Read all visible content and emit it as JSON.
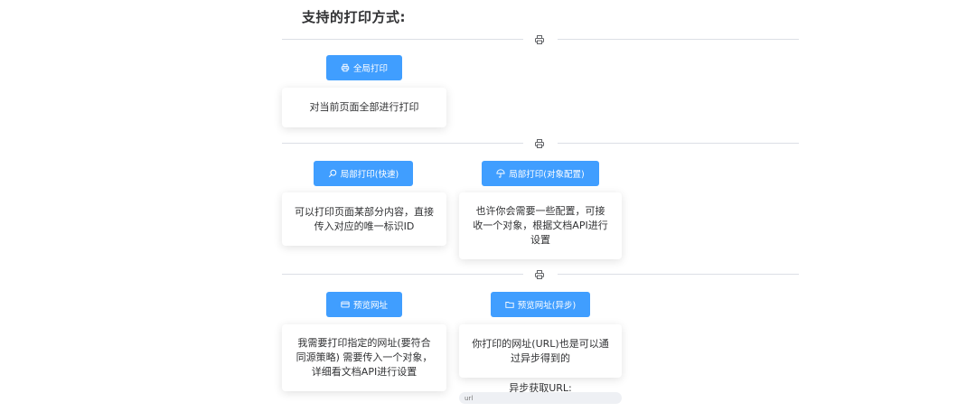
{
  "title": "支持的打印方式:",
  "dividers": [
    {
      "icon": "printer-icon"
    },
    {
      "icon": "printer-icon"
    },
    {
      "icon": "printer-icon"
    }
  ],
  "sections": {
    "full": {
      "button_label": "全局打印",
      "button_icon": "printer-icon",
      "description": "对当前页面全部进行打印"
    },
    "partial_fast": {
      "button_label": "局部打印(快速)",
      "button_icon": "search-icon",
      "description": "可以打印页面某部分内容，直接传入对应的唯一标识ID"
    },
    "partial_config": {
      "button_label": "局部打印(对象配置)",
      "button_icon": "umbrella-icon",
      "description": "也许你会需要一些配置，可接收一个对象，根据文档API进行设置"
    },
    "preview_url": {
      "button_label": "预览网址",
      "button_icon": "credit-card-icon",
      "description": "我需要打印指定的网址(要符合同源策略) 需要传入一个对象，详细看文档API进行设置"
    },
    "preview_url_async": {
      "button_label": "预览网址(异步)",
      "button_icon": "folder-icon",
      "description": "你打印的网址(URL)也是可以通过异步得到的"
    }
  },
  "async_url": {
    "label": "异步获取URL:",
    "placeholder": "url"
  },
  "colors": {
    "primary": "#409eff",
    "divider": "#dcdfe6",
    "text": "#303133"
  }
}
